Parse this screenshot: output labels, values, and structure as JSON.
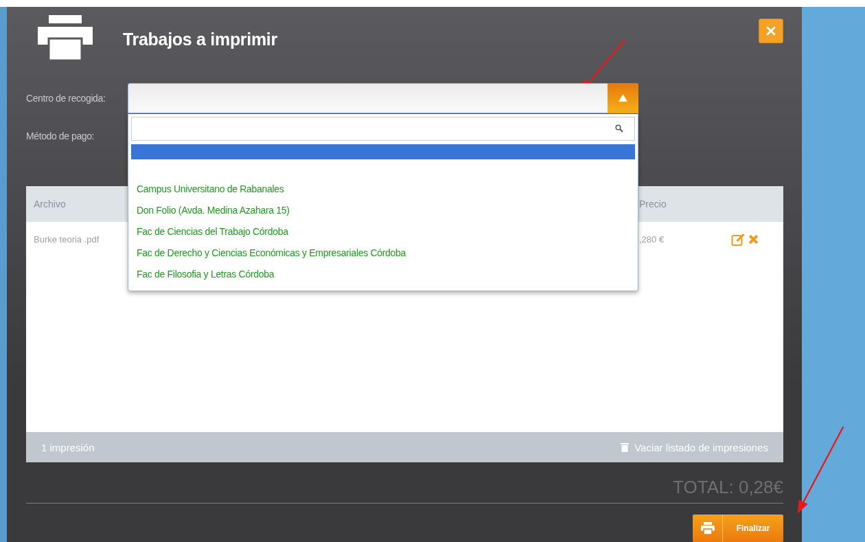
{
  "dialog": {
    "title": "Trabajos a imprimir"
  },
  "form": {
    "fields": [
      {
        "label": "Centro de recogida:",
        "kind": "select",
        "expanded": true
      },
      {
        "label": "Método de pago:",
        "kind": "select",
        "expanded": false
      }
    ]
  },
  "dropdown": {
    "blank_option": {
      "selected": true
    },
    "options": [
      {
        "label": "Campus Universitano de Rabanales",
        "selected": false
      },
      {
        "label": "Don Folio (Avda. Medina Azahara 15)",
        "selected": false
      },
      {
        "label": "Fac de Ciencias del Trabajo Córdoba",
        "selected": false
      },
      {
        "label": "Fac de Derecho y Ciencias Económicas y Empresariales Córdoba",
        "selected": false
      },
      {
        "label": "Fac de Filosofia y Letras Córdoba",
        "selected": false
      }
    ]
  },
  "table": {
    "columns": [
      "Archivo",
      "Precio"
    ],
    "rows": [
      {
        "file": "Burke teoria .pdf",
        "price": ",280 €"
      }
    ],
    "footer": {
      "count": "1 impresión",
      "clear_action": "Vaciar listado de impresiones"
    }
  },
  "total": "TOTAL: 0,28€",
  "buttons": {
    "finish": "Finalizar"
  }
}
